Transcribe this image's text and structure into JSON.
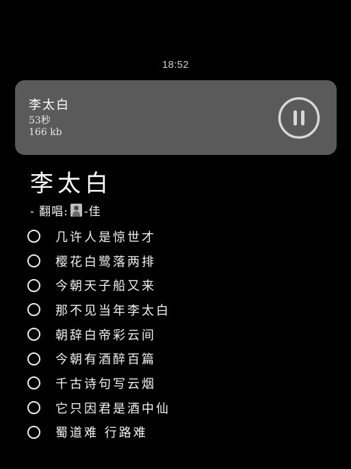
{
  "status": {
    "time": "18:52"
  },
  "player": {
    "title": "李太白",
    "duration": "53秒",
    "size": "166 kb",
    "control_icon": "pause-icon"
  },
  "song": {
    "title": "李太白",
    "singer_prefix": "- 翻唱:",
    "singer_suffix": "-佳"
  },
  "lyrics": [
    "几许人是惊世才",
    "樱花白鹭落两排",
    "今朝天子船又来",
    "那不见当年李太白",
    "朝辞白帝彩云间",
    "今朝有酒醉百篇",
    "千古诗句写云烟",
    "它只因君是酒中仙",
    "蜀道难 行路难"
  ]
}
